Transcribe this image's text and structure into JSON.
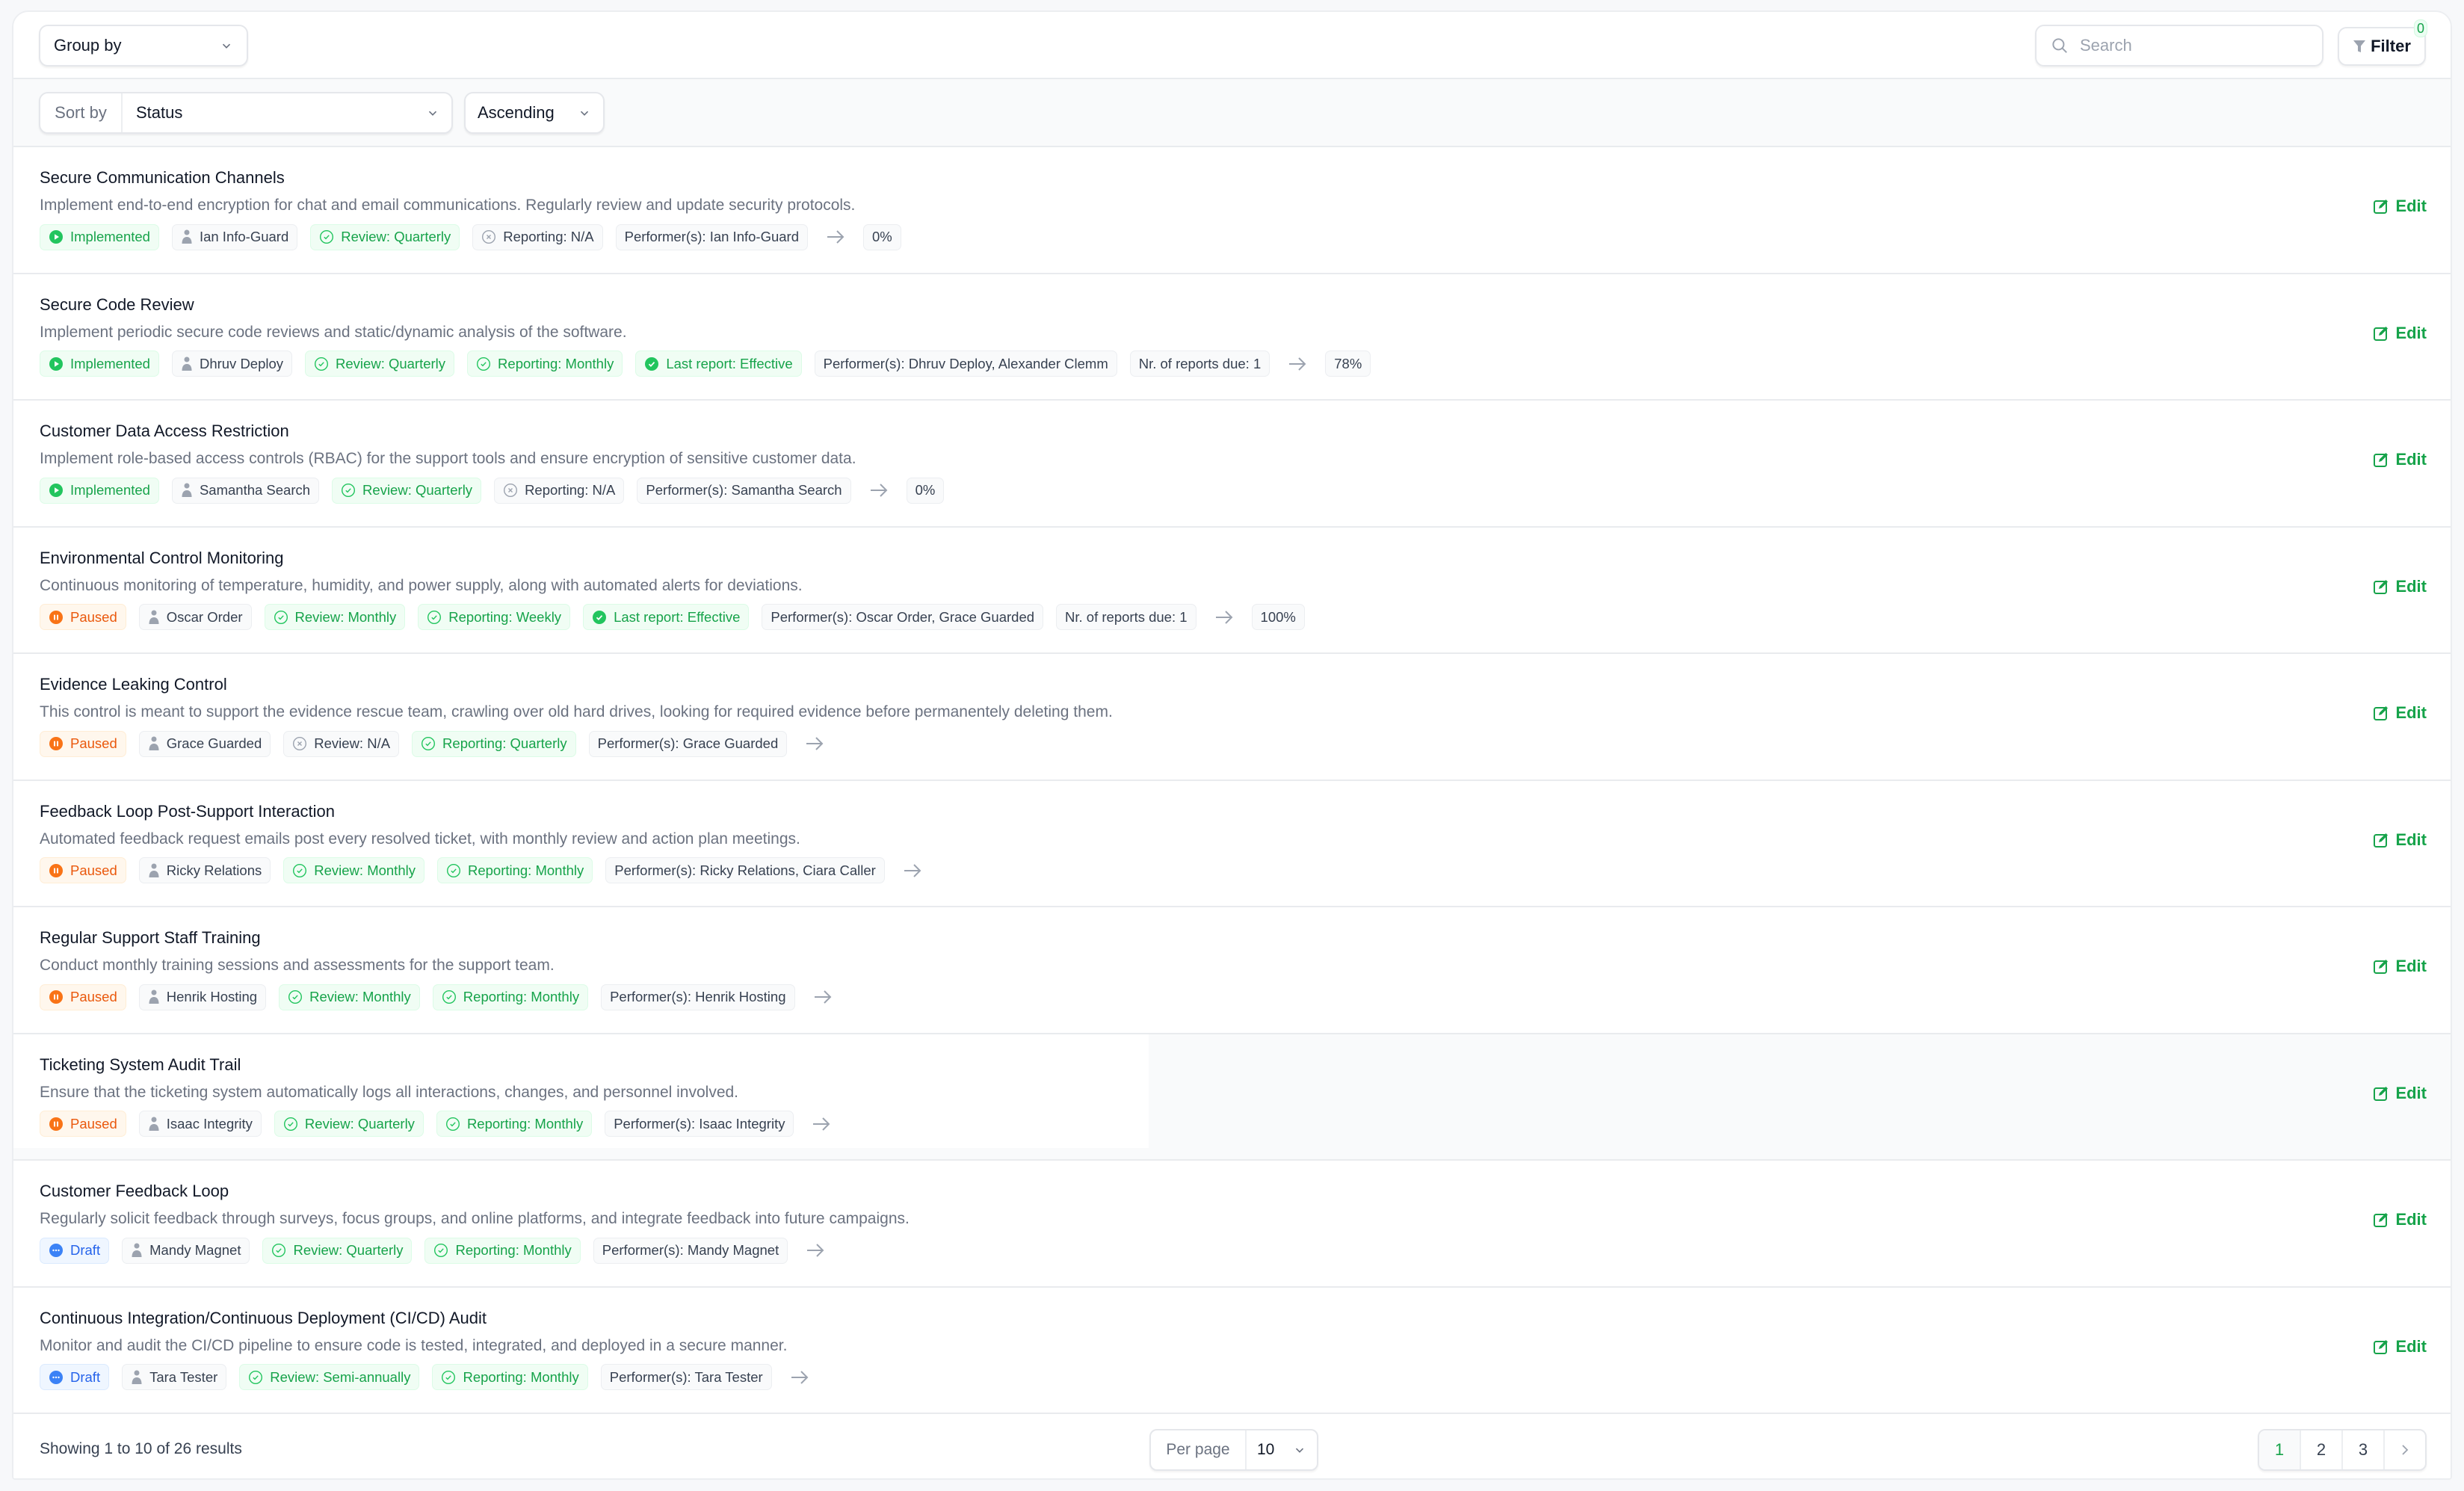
{
  "toolbar": {
    "group_by_label": "Group by",
    "search_placeholder": "Search",
    "search_value": "",
    "filter_label": "Filter",
    "filter_count": "0"
  },
  "sort": {
    "label": "Sort by",
    "value": "Status",
    "order": "Ascending"
  },
  "colors": {
    "accent_green": "#16a34a",
    "paused_orange": "#ea580c",
    "draft_blue": "#2563eb"
  },
  "rows": [
    {
      "title": "Secure Communication Channels",
      "description": "Implement end-to-end encryption for chat and email communications. Regularly review and update security protocols.",
      "status": {
        "label": "Implemented",
        "type": "implemented"
      },
      "owner": "Ian Info-Guard",
      "review": {
        "label": "Review: Quarterly",
        "state": "ok"
      },
      "reporting": {
        "label": "Reporting: N/A",
        "state": "na"
      },
      "last_report": null,
      "performers": "Performer(s): Ian Info-Guard",
      "reports_due": null,
      "progress": "0%"
    },
    {
      "title": "Secure Code Review",
      "description": "Implement periodic secure code reviews and static/dynamic analysis of the software.",
      "status": {
        "label": "Implemented",
        "type": "implemented"
      },
      "owner": "Dhruv Deploy",
      "review": {
        "label": "Review: Quarterly",
        "state": "ok"
      },
      "reporting": {
        "label": "Reporting: Monthly",
        "state": "ok"
      },
      "last_report": "Last report: Effective",
      "performers": "Performer(s): Dhruv Deploy, Alexander Clemm",
      "reports_due": "Nr. of reports due: 1",
      "progress": "78%"
    },
    {
      "title": "Customer Data Access Restriction",
      "description": "Implement role-based access controls (RBAC) for the support tools and ensure encryption of sensitive customer data.",
      "status": {
        "label": "Implemented",
        "type": "implemented"
      },
      "owner": "Samantha Search",
      "review": {
        "label": "Review: Quarterly",
        "state": "ok"
      },
      "reporting": {
        "label": "Reporting: N/A",
        "state": "na"
      },
      "last_report": null,
      "performers": "Performer(s): Samantha Search",
      "reports_due": null,
      "progress": "0%"
    },
    {
      "title": "Environmental Control Monitoring",
      "description": "Continuous monitoring of temperature, humidity, and power supply, along with automated alerts for deviations.",
      "status": {
        "label": "Paused",
        "type": "paused"
      },
      "owner": "Oscar Order",
      "review": {
        "label": "Review: Monthly",
        "state": "ok"
      },
      "reporting": {
        "label": "Reporting: Weekly",
        "state": "ok"
      },
      "last_report": "Last report: Effective",
      "performers": "Performer(s): Oscar Order, Grace Guarded",
      "reports_due": "Nr. of reports due: 1",
      "progress": "100%"
    },
    {
      "title": "Evidence Leaking Control",
      "description": "This control is meant to support the evidence rescue team, crawling over old hard drives, looking for required evidence before permanentely deleting them.",
      "status": {
        "label": "Paused",
        "type": "paused"
      },
      "owner": "Grace Guarded",
      "review": {
        "label": "Review: N/A",
        "state": "na"
      },
      "reporting": {
        "label": "Reporting: Quarterly",
        "state": "ok"
      },
      "last_report": null,
      "performers": "Performer(s): Grace Guarded",
      "reports_due": null,
      "progress": null
    },
    {
      "title": "Feedback Loop Post-Support Interaction",
      "description": "Automated feedback request emails post every resolved ticket, with monthly review and action plan meetings.",
      "status": {
        "label": "Paused",
        "type": "paused"
      },
      "owner": "Ricky Relations",
      "review": {
        "label": "Review: Monthly",
        "state": "ok"
      },
      "reporting": {
        "label": "Reporting: Monthly",
        "state": "ok"
      },
      "last_report": null,
      "performers": "Performer(s): Ricky Relations, Ciara Caller",
      "reports_due": null,
      "progress": null
    },
    {
      "title": "Regular Support Staff Training",
      "description": "Conduct monthly training sessions and assessments for the support team.",
      "status": {
        "label": "Paused",
        "type": "paused"
      },
      "owner": "Henrik Hosting",
      "review": {
        "label": "Review: Monthly",
        "state": "ok"
      },
      "reporting": {
        "label": "Reporting: Monthly",
        "state": "ok"
      },
      "last_report": null,
      "performers": "Performer(s): Henrik Hosting",
      "reports_due": null,
      "progress": null
    },
    {
      "title": "Ticketing System Audit Trail",
      "description": "Ensure that the ticketing system automatically logs all interactions, changes, and personnel involved.",
      "status": {
        "label": "Paused",
        "type": "paused"
      },
      "owner": "Isaac Integrity",
      "review": {
        "label": "Review: Quarterly",
        "state": "ok"
      },
      "reporting": {
        "label": "Reporting: Monthly",
        "state": "ok"
      },
      "last_report": null,
      "performers": "Performer(s): Isaac Integrity",
      "reports_due": null,
      "progress": null,
      "hovered": true
    },
    {
      "title": "Customer Feedback Loop",
      "description": "Regularly solicit feedback through surveys, focus groups, and online platforms, and integrate feedback into future campaigns.",
      "status": {
        "label": "Draft",
        "type": "draft"
      },
      "owner": "Mandy Magnet",
      "review": {
        "label": "Review: Quarterly",
        "state": "ok"
      },
      "reporting": {
        "label": "Reporting: Monthly",
        "state": "ok"
      },
      "last_report": null,
      "performers": "Performer(s): Mandy Magnet",
      "reports_due": null,
      "progress": null
    },
    {
      "title": "Continuous Integration/Continuous Deployment (CI/CD) Audit",
      "description": "Monitor and audit the CI/CD pipeline to ensure code is tested, integrated, and deployed in a secure manner.",
      "status": {
        "label": "Draft",
        "type": "draft"
      },
      "owner": "Tara Tester",
      "review": {
        "label": "Review: Semi-annually",
        "state": "ok"
      },
      "reporting": {
        "label": "Reporting: Monthly",
        "state": "ok"
      },
      "last_report": null,
      "performers": "Performer(s): Tara Tester",
      "reports_due": null,
      "progress": null
    }
  ],
  "edit_label": "Edit",
  "footer": {
    "showing": "Showing 1 to 10 of 26 results",
    "per_page_label": "Per page",
    "per_page_value": "10",
    "pages": [
      "1",
      "2",
      "3"
    ],
    "current_page": "1"
  }
}
